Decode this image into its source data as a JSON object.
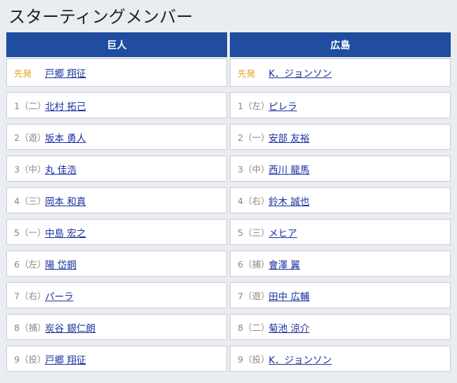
{
  "page_title": "スターティングメンバー",
  "teams": [
    {
      "name": "巨人",
      "starter": {
        "position": "先発",
        "player": "戸郷 翔征"
      },
      "lineup": [
        {
          "position": "1（二）",
          "player": "北村 拓己"
        },
        {
          "position": "2（遊）",
          "player": "坂本 勇人"
        },
        {
          "position": "3（中）",
          "player": "丸 佳浩"
        },
        {
          "position": "4（三）",
          "player": "岡本 和真"
        },
        {
          "position": "5（一）",
          "player": "中島 宏之"
        },
        {
          "position": "6（左）",
          "player": "陽 岱鋼"
        },
        {
          "position": "7（右）",
          "player": "パーラ"
        },
        {
          "position": "8（捕）",
          "player": "炭谷 銀仁朗"
        },
        {
          "position": "9（投）",
          "player": "戸郷 翔征"
        }
      ]
    },
    {
      "name": "広島",
      "starter": {
        "position": "先発",
        "player": "K．ジョンソン"
      },
      "lineup": [
        {
          "position": "1（左）",
          "player": "ピレラ"
        },
        {
          "position": "2（一）",
          "player": "安部 友裕"
        },
        {
          "position": "3（中）",
          "player": "西川 龍馬"
        },
        {
          "position": "4（右）",
          "player": "鈴木 誠也"
        },
        {
          "position": "5（三）",
          "player": "メヒア"
        },
        {
          "position": "6（捕）",
          "player": "會澤 翼"
        },
        {
          "position": "7（遊）",
          "player": "田中 広輔"
        },
        {
          "position": "8（二）",
          "player": "菊池 涼介"
        },
        {
          "position": "9（投）",
          "player": "K．ジョンソン"
        }
      ]
    }
  ],
  "colors": {
    "header_bg": "#1f4ea1",
    "starter_label": "#e8a020",
    "link": "#1a2fa0"
  }
}
